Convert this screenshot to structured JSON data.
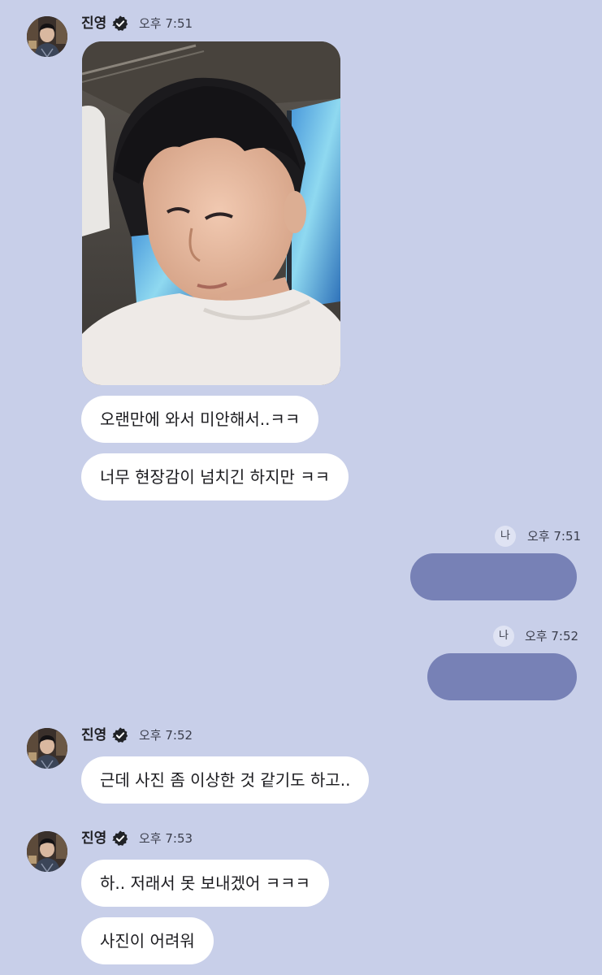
{
  "messages": [
    {
      "sender": "진영",
      "time": "오후 7:51",
      "texts": [
        "오랜만에 와서 미안해서..ㅋㅋ",
        "너무 현장감이 넘치긴 하지만 ㅋㅋ"
      ]
    },
    {
      "me_badge": "나",
      "time": "오후 7:51"
    },
    {
      "me_badge": "나",
      "time": "오후 7:52"
    },
    {
      "sender": "진영",
      "time": "오후 7:52",
      "texts": [
        "근데 사진 좀 이상한 것 같기도 하고.."
      ]
    },
    {
      "sender": "진영",
      "time": "오후 7:53",
      "texts": [
        "하.. 저래서 못 보내겠어 ㅋㅋㅋ",
        "사진이 어려워"
      ]
    }
  ],
  "colors": {
    "background": "#c8cfe9",
    "my_bubble": "#7781b6",
    "their_bubble": "#ffffff"
  }
}
